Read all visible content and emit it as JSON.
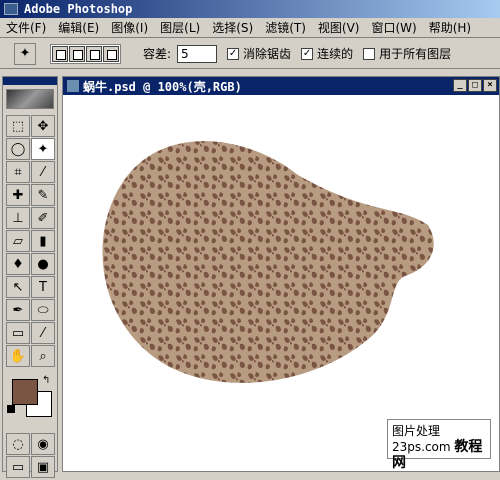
{
  "app": {
    "title": "Adobe Photoshop"
  },
  "menu": [
    "文件(F)",
    "编辑(E)",
    "图像(I)",
    "图层(L)",
    "选择(S)",
    "滤镜(T)",
    "视图(V)",
    "窗口(W)",
    "帮助(H)"
  ],
  "options": {
    "tolerance_label": "容差:",
    "tolerance_value": "5",
    "antialias_label": "消除锯齿",
    "antialias_checked": true,
    "contiguous_label": "连续的",
    "contiguous_checked": true,
    "all_layers_label": "用于所有图层",
    "all_layers_checked": false
  },
  "document": {
    "title": "蜗牛.psd @ 100%(壳,RGB)"
  },
  "colors": {
    "foreground": "#7b5544",
    "background": "#ffffff",
    "shell_light": "#b89c82",
    "shell_dark": "#7b5544"
  },
  "watermark": {
    "line1": "图片处理",
    "line2a": "23ps.com",
    "line2b": "教程网"
  },
  "tools": [
    "marquee-icon",
    "move-icon",
    "lasso-icon",
    "magic-wand-icon",
    "crop-icon",
    "eyedropper-slice-icon",
    "healing-icon",
    "brush-icon",
    "stamp-icon",
    "history-brush-icon",
    "eraser-icon",
    "gradient-icon",
    "blur-icon",
    "dodge-icon",
    "path-select-icon",
    "type-icon",
    "pen-icon",
    "ellipse-icon",
    "notes-icon",
    "eyedropper-icon",
    "hand-icon",
    "zoom-icon"
  ]
}
